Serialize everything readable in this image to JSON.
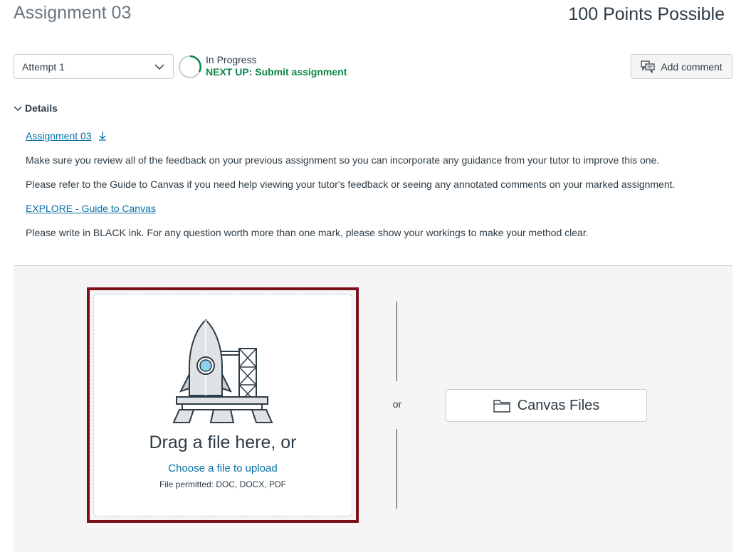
{
  "header": {
    "title": "Assignment 03",
    "points": "100 Points Possible"
  },
  "attempt": {
    "selected": "Attempt 1",
    "icon": "chevron-down-icon"
  },
  "status": {
    "state": "In Progress",
    "next_up": "NEXT UP: Submit assignment",
    "progress_color": "#0b874b"
  },
  "add_comment": {
    "label": "Add comment",
    "icon": "comment-icon"
  },
  "details": {
    "toggle_label": "Details",
    "file_link": "Assignment 03",
    "line1": "Make sure you review all of the feedback on your previous assignment so you can incorporate any guidance from your tutor to improve this one.",
    "line2": "Please refer to the Guide to Canvas if you need help viewing your tutor's feedback or seeing any annotated comments on your marked assignment.",
    "guide_link": "EXPLORE - Guide to Canvas",
    "line3": "Please write in BLACK ink. For any question worth more than one mark, please show your workings to make your method clear."
  },
  "upload": {
    "drag_text": "Drag a file here, or",
    "choose_link": "Choose a file to upload",
    "permitted": "File permitted: DOC, DOCX, PDF",
    "or_label": "or",
    "canvas_files_label": "Canvas Files",
    "highlight_color": "#7b0f1c",
    "link_color": "#0770a3"
  }
}
